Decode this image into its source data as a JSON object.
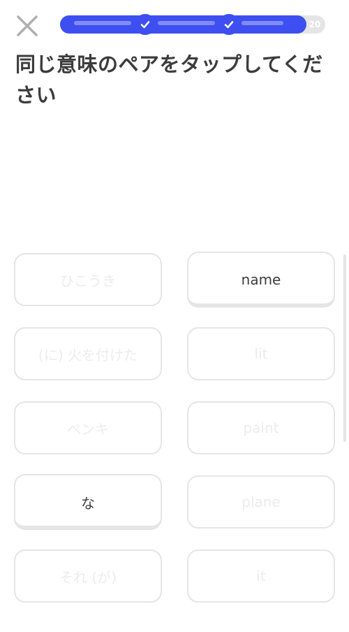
{
  "header": {
    "close_icon": "close-icon",
    "progress": {
      "fraction": 0.93,
      "checkpoints": [
        "check-icon",
        "check-icon"
      ],
      "goal_count": "20",
      "fill_color": "#3d4ff0",
      "track_color": "#e5e5e5"
    }
  },
  "title": "同じ意味のペアをタップしてください",
  "pairs": {
    "left": [
      {
        "label": "ひこうき",
        "state": "matched"
      },
      {
        "label": "(に) 火を付けた",
        "state": "matched"
      },
      {
        "label": "ペンキ",
        "state": "matched"
      },
      {
        "label": "な",
        "state": "active"
      },
      {
        "label": "それ (が)",
        "state": "matched"
      }
    ],
    "right": [
      {
        "label": "name",
        "state": "active"
      },
      {
        "label": "lit",
        "state": "matched"
      },
      {
        "label": "paint",
        "state": "matched"
      },
      {
        "label": "plane",
        "state": "matched"
      },
      {
        "label": "it",
        "state": "matched"
      }
    ]
  }
}
